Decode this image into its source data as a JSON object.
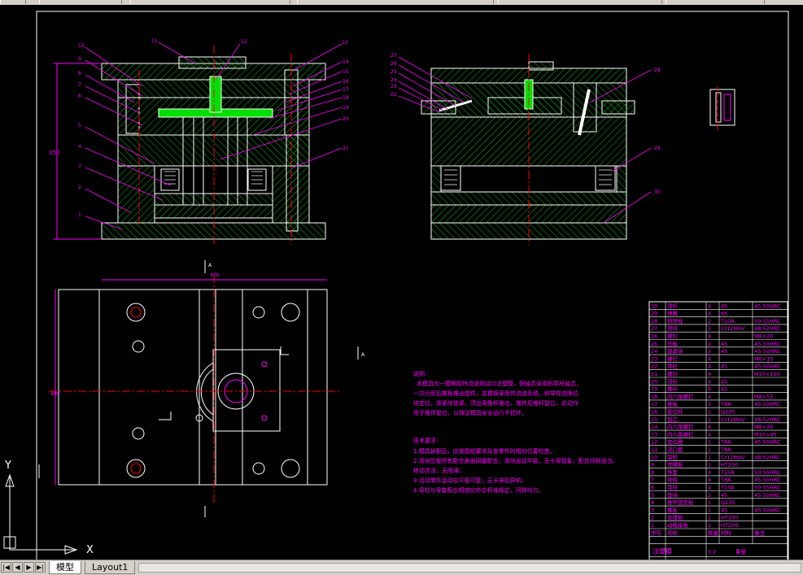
{
  "layout_tabs": [
    {
      "label": "模型",
      "active": true
    },
    {
      "label": "Layout1",
      "active": false
    }
  ],
  "nav_buttons": [
    "first-tab",
    "prev-tab",
    "next-tab",
    "last-tab"
  ],
  "ucs": {
    "x_label": "X",
    "y_label": "Y"
  },
  "section_labels": {
    "top_left": "A",
    "mid_right": "A"
  },
  "notes": {
    "heading": "说明:",
    "body_lines": [
      "本模具为一模两腔热流道侧浇口注塑模，侧抽芯采用斜导柱抽芯，",
      "一次分型后推板推出塑件，定模板采用热流道系统，斜导柱由限位",
      "块定位，锁紧块锁紧，顶出用推杆推出，推件后推杆复位，此动作",
      "用于推件复位，以保证模具安全运行不损坏。"
    ],
    "tech_heading": "技术要求:",
    "tech_lines": [
      "1.模具装配后，应按图纸要求及各零件的相对位置检查。",
      "2.滑块应按所有配合表面研磨配合，滑块运动平稳，无卡滞现象，配合间隙适当，",
      "  移动灵活，无阻滞。",
      "3.活动零件运动应平稳可靠，无卡滞及异响。",
      "4.导柱与导套配合精度应符合标准规定，间隙均匀。"
    ]
  },
  "bom_rows": [
    [
      "30",
      "顶杆",
      "4",
      "45",
      "45-50HRC"
    ],
    [
      "29",
      "弹簧",
      "4",
      "65",
      ""
    ],
    [
      "28",
      "斜导柱",
      "2",
      "T10A",
      "50-55HRC"
    ],
    [
      "27",
      "滑块",
      "2",
      "Cr12MoV",
      "48-52HRC"
    ],
    [
      "26",
      "螺钉",
      "4",
      "",
      "M8×20"
    ],
    [
      "25",
      "压板",
      "2",
      "45",
      "45-50HRC"
    ],
    [
      "24",
      "锁紧块",
      "2",
      "45",
      "45-50HRC"
    ],
    [
      "23",
      "螺钉",
      "4",
      "",
      "M6×15"
    ],
    [
      "22",
      "导柱",
      "4",
      "45",
      "45-50HRC"
    ],
    [
      "21",
      "螺钉",
      "4",
      "",
      "M10×150"
    ],
    [
      "20",
      "顶杆",
      "4",
      "45",
      ""
    ],
    [
      "19",
      "推杆",
      "6",
      "45",
      ""
    ],
    [
      "18",
      "内六角螺钉",
      "4",
      "",
      "M8×55"
    ],
    [
      "17",
      "推板",
      "1",
      "T8A",
      "45-50HRC"
    ],
    [
      "16",
      "复位杆",
      "1",
      "Q235",
      ""
    ],
    [
      "15",
      "型芯",
      "1",
      "Cr12MoV",
      "48-52HRC"
    ],
    [
      "14",
      "内六角螺钉",
      "4",
      "",
      "M8×20"
    ],
    [
      "13",
      "内六角螺钉",
      "4",
      "",
      "M10×45"
    ],
    [
      "12",
      "定位圈",
      "1",
      "T8A",
      "45-50HRC"
    ],
    [
      "11",
      "浇口套",
      "1",
      "T8A",
      ""
    ],
    [
      "10",
      "型腔",
      "1",
      "Cr12MoV",
      "48-52HRC"
    ],
    [
      "9",
      "定模板",
      "1",
      "HT200",
      ""
    ],
    [
      "8",
      "导套",
      "4",
      "T10A",
      "50-55HRC"
    ],
    [
      "7",
      "导柱",
      "4",
      "T8A",
      "45-50HRC"
    ],
    [
      "6",
      "导柱",
      "4",
      "T10A",
      "50-55HRC"
    ],
    [
      "5",
      "垫块",
      "2",
      "45",
      "45-50HRC"
    ],
    [
      "4",
      "推杆固定板",
      "1",
      "Q235",
      ""
    ],
    [
      "3",
      "推板",
      "1",
      "45",
      "45-50HRC"
    ],
    [
      "2",
      "支撑板",
      "1",
      "HT200",
      ""
    ],
    [
      "1",
      "动模座板",
      "1",
      "HT200",
      ""
    ]
  ],
  "bom_header": [
    "序号",
    "名称",
    "数量",
    "材料",
    "备注"
  ],
  "title_block": {
    "name": "注塑模",
    "scale": "1:2",
    "weight_label": "重量",
    "sheet_label": "共 张"
  },
  "callouts_left": [
    "10",
    "9",
    "8",
    "7",
    "6",
    "5",
    "4",
    "3",
    "2",
    "1"
  ],
  "callouts_top": [
    "11",
    "12",
    "13"
  ],
  "callouts_right_left_view": [
    "14",
    "15",
    "16",
    "17",
    "18",
    "19",
    "20",
    "21"
  ],
  "callouts_right_view_left": [
    "27",
    "26",
    "25",
    "24",
    "23",
    "22"
  ],
  "callouts_right_view_right": [
    "28",
    "29",
    "30"
  ],
  "dimensions": {
    "height": "350",
    "width_plan": "400",
    "height_plan": "400"
  }
}
